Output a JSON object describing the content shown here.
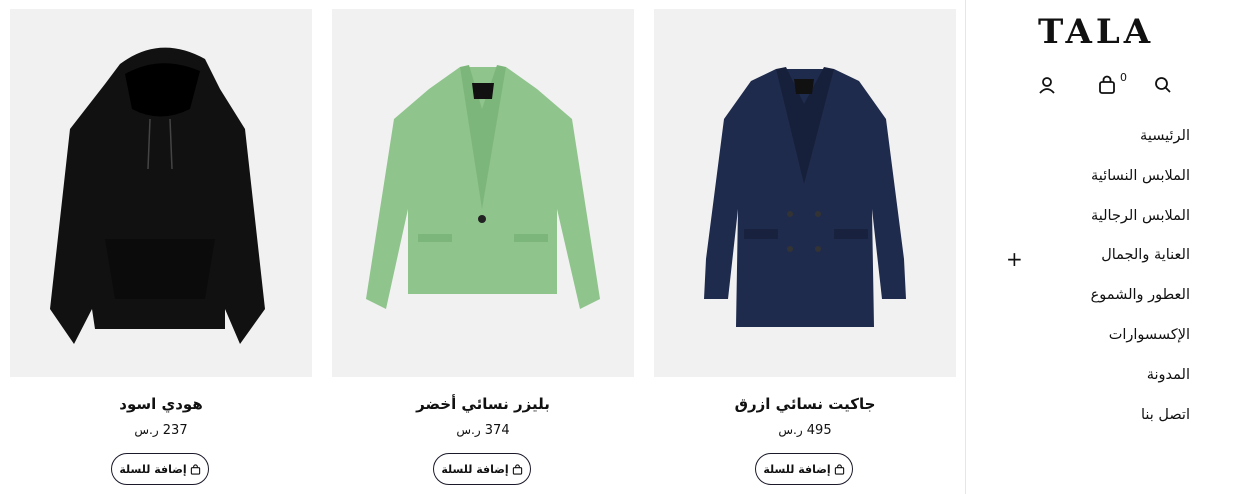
{
  "brand": {
    "logo": "TALA"
  },
  "header": {
    "cart_count": "0",
    "icons": [
      "search-icon",
      "bag-icon",
      "user-icon"
    ]
  },
  "nav": {
    "items": [
      {
        "label": "الرئيسية"
      },
      {
        "label": "الملابس النسائية"
      },
      {
        "label": "الملابس الرجالية"
      },
      {
        "label": "العناية والجمال"
      },
      {
        "label": "العطور والشموع"
      },
      {
        "label": "الإكسسوارات"
      },
      {
        "label": "المدونة"
      },
      {
        "label": "اتصل بنا"
      }
    ],
    "expand_symbol": "+"
  },
  "products": [
    {
      "name": "جاكيت نسائي ازرق",
      "price": "495",
      "currency": "ر.س",
      "button": "إضافة للسلة",
      "color": "#1f2b4d"
    },
    {
      "name": "بليزر نسائي أخضر",
      "price": "374",
      "currency": "ر.س",
      "button": "إضافة للسلة",
      "color": "#8fc48c"
    },
    {
      "name": "هودي اسود",
      "price": "237",
      "currency": "ر.س",
      "button": "إضافة للسلة",
      "color": "#111111"
    }
  ]
}
